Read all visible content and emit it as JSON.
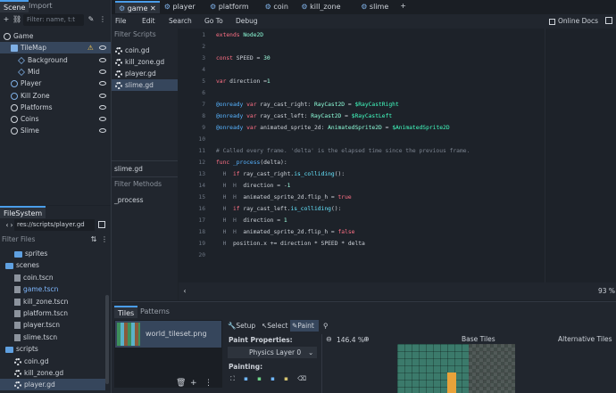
{
  "scene_dock": {
    "tabs": [
      "Scene",
      "Import"
    ],
    "filter_placeholder": "Filter: name, t:t",
    "tree": [
      {
        "label": "Game",
        "icon": "node2d-icon",
        "indent": 0,
        "selected": false
      },
      {
        "label": "TileMap",
        "icon": "tilemap-icon",
        "indent": 1,
        "selected": true,
        "warning": true
      },
      {
        "label": "Background",
        "icon": "tilemap-layer-icon",
        "indent": 2,
        "selected": false
      },
      {
        "label": "Mid",
        "icon": "tilemap-layer-icon",
        "indent": 2,
        "selected": false
      },
      {
        "label": "Player",
        "icon": "characterbody-icon",
        "indent": 1,
        "selected": false
      },
      {
        "label": "Kill Zone",
        "icon": "area2d-icon",
        "indent": 1,
        "selected": false
      },
      {
        "label": "Platforms",
        "icon": "node2d-icon",
        "indent": 1,
        "selected": false
      },
      {
        "label": "Coins",
        "icon": "node2d-icon",
        "indent": 1,
        "selected": false
      },
      {
        "label": "Slime",
        "icon": "node2d-icon",
        "indent": 1,
        "selected": false
      }
    ]
  },
  "filesystem": {
    "title": "FileSystem",
    "path": "res://scripts/player.gd",
    "filter_placeholder": "Filter Files",
    "items": [
      {
        "label": "sprites",
        "type": "folder",
        "indent": 1
      },
      {
        "label": "scenes",
        "type": "folder",
        "indent": 0
      },
      {
        "label": "coin.tscn",
        "type": "scene",
        "indent": 1
      },
      {
        "label": "game.tscn",
        "type": "scene",
        "indent": 1,
        "highlight": true
      },
      {
        "label": "kill_zone.tscn",
        "type": "scene",
        "indent": 1
      },
      {
        "label": "platform.tscn",
        "type": "scene",
        "indent": 1
      },
      {
        "label": "player.tscn",
        "type": "scene",
        "indent": 1
      },
      {
        "label": "slime.tscn",
        "type": "scene",
        "indent": 1
      },
      {
        "label": "scripts",
        "type": "folder",
        "indent": 0
      },
      {
        "label": "coin.gd",
        "type": "script",
        "indent": 1
      },
      {
        "label": "kill_zone.gd",
        "type": "script",
        "indent": 1
      },
      {
        "label": "player.gd",
        "type": "script",
        "indent": 1,
        "selected": true
      }
    ]
  },
  "editor_tabs": [
    {
      "label": "game",
      "active": true
    },
    {
      "label": "player",
      "active": false
    },
    {
      "label": "platform",
      "active": false
    },
    {
      "label": "coin",
      "active": false
    },
    {
      "label": "kill_zone",
      "active": false
    },
    {
      "label": "slime",
      "active": false
    }
  ],
  "menu": {
    "items": [
      "File",
      "Edit",
      "Search",
      "Go To",
      "Debug"
    ],
    "online_docs": "Online Docs"
  },
  "script_list": {
    "filter_placeholder": "Filter Scripts",
    "scripts": [
      {
        "label": "coin.gd",
        "selected": false
      },
      {
        "label": "kill_zone.gd",
        "selected": false
      },
      {
        "label": "player.gd",
        "selected": false
      },
      {
        "label": "slime.gd",
        "selected": true
      }
    ],
    "current_script": "slime.gd",
    "methods_placeholder": "Filter Methods",
    "methods": [
      "_process"
    ]
  },
  "code_lines": [
    {
      "n": "1",
      "html": "<span class='kw'>extends</span> <span class='ty'>Node2D</span>"
    },
    {
      "n": "2",
      "html": ""
    },
    {
      "n": "3",
      "html": "<span class='kw'>const</span> SPEED = <span class='nm'>30</span>"
    },
    {
      "n": "4",
      "html": ""
    },
    {
      "n": "5",
      "html": "<span class='kw'>var</span> direction =<span class='nm'>1</span>"
    },
    {
      "n": "6",
      "html": ""
    },
    {
      "n": "7",
      "html": "<span class='fn'>@onready</span> <span class='kw'>var</span> ray_cast_right: <span class='ty'>RayCast2D</span> = <span class='nd'>$RayCastRight</span>"
    },
    {
      "n": "8",
      "html": "<span class='fn'>@onready</span> <span class='kw'>var</span> ray_cast_left: <span class='ty'>RayCast2D</span> = <span class='nd'>$RayCastLeft</span>"
    },
    {
      "n": "9",
      "html": "<span class='fn'>@onready</span> <span class='kw'>var</span> animated_sprite_2d: <span class='ty'>AnimatedSprite2D</span> = <span class='nd'>$AnimatedSprite2D</span>"
    },
    {
      "n": "10",
      "html": ""
    },
    {
      "n": "11",
      "html": "<span class='cm'># Called every frame. 'delta' is the elapsed time since the previous frame.</span>"
    },
    {
      "n": "12",
      "html": "<span class='kw'>func</span> <span class='fn'>_process</span>(delta):"
    },
    {
      "n": "13",
      "html": "<span class='cm'>  H  </span><span class='kw'>if</span> ray_cast_right.<span class='ref'>is_colliding</span>():"
    },
    {
      "n": "14",
      "html": "<span class='cm'>  H  H  </span>direction = -<span class='nm'>1</span>"
    },
    {
      "n": "15",
      "html": "<span class='cm'>  H  H  </span>animated_sprite_2d.flip_h = <span class='kw'>true</span>"
    },
    {
      "n": "16",
      "html": "<span class='cm'>  H  </span><span class='kw'>if</span> ray_cast_left.<span class='ref'>is_colliding</span>():"
    },
    {
      "n": "17",
      "html": "<span class='cm'>  H  H  </span>direction = <span class='nm'>1</span>"
    },
    {
      "n": "18",
      "html": "<span class='cm'>  H  H  </span>animated_sprite_2d.flip_h = <span class='kw'>false</span>"
    },
    {
      "n": "19",
      "html": "<span class='cm'>  H  </span>position.x += direction * SPEED * delta"
    },
    {
      "n": "20",
      "html": ""
    }
  ],
  "code_status": {
    "zoom": "93 %"
  },
  "bottom_panel": {
    "tabs": [
      "Tiles",
      "Patterns"
    ],
    "tileset_item": "world_tileset.png",
    "tool_tabs": [
      "Setup",
      "Select",
      "Paint"
    ],
    "paint_properties_label": "Paint Properties:",
    "physics_layer": "Physics Layer 0",
    "painting_label": "Painting:",
    "zoom": "146.4 %",
    "base_tiles_label": "Base Tiles",
    "alternative_tiles_label": "Alternative Tiles"
  },
  "colors": {
    "accent": "#4a9dea",
    "selection": "#36465c",
    "bg": "#1d2229"
  }
}
